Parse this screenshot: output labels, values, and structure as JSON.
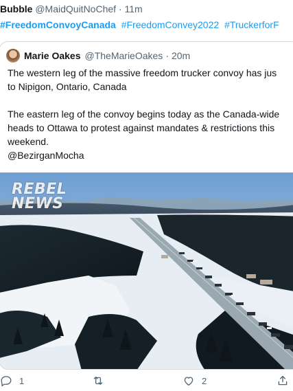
{
  "tweet": {
    "author_name": "Bubble",
    "handle": "@MaidQuitNoChef",
    "separator": "·",
    "time": "11m",
    "hashtags": [
      "#FreedomConvoyCanada",
      "#FreedomConvey2022",
      "#TruckerforF"
    ]
  },
  "quoted_tweet": {
    "author_name": "Marie Oakes",
    "handle": "@TheMarieOakes",
    "separator": "·",
    "time": "20m",
    "lines": [
      "The western leg of the massive freedom trucker convoy has jus",
      "to Nipigon, Ontario, Canada",
      "",
      "The eastern leg of the convoy begins today as the Canada-wide",
      "heads to Ottawa to protest against mandates & restrictions this",
      "weekend.",
      "@BezirganMocha"
    ],
    "media": {
      "watermark_line1": "REBEL",
      "watermark_line2": "NEWS"
    }
  },
  "actions": {
    "reply_icon": "reply-icon",
    "reply_count": "1",
    "retweet_icon": "retweet-icon",
    "like_icon": "heart-icon",
    "like_count": "2",
    "share_icon": "share-icon"
  }
}
